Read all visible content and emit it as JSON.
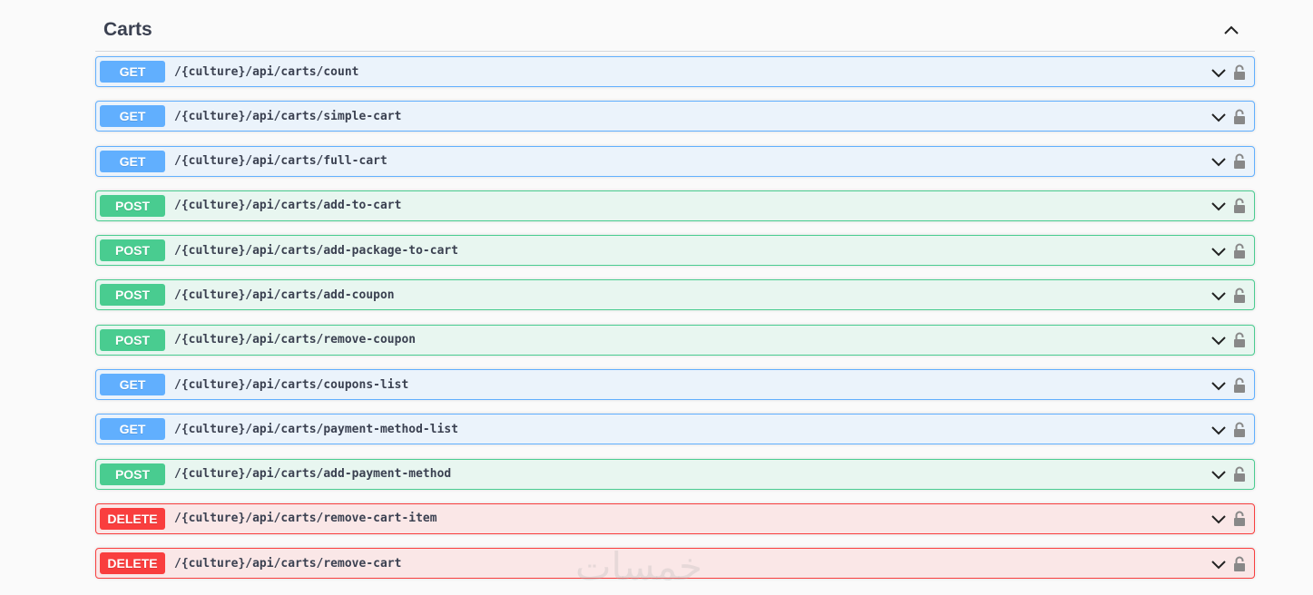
{
  "tag": {
    "title": "Carts"
  },
  "operations": [
    {
      "method": "GET",
      "path": "/{culture}/api/carts/count"
    },
    {
      "method": "GET",
      "path": "/{culture}/api/carts/simple-cart"
    },
    {
      "method": "GET",
      "path": "/{culture}/api/carts/full-cart"
    },
    {
      "method": "POST",
      "path": "/{culture}/api/carts/add-to-cart"
    },
    {
      "method": "POST",
      "path": "/{culture}/api/carts/add-package-to-cart"
    },
    {
      "method": "POST",
      "path": "/{culture}/api/carts/add-coupon"
    },
    {
      "method": "POST",
      "path": "/{culture}/api/carts/remove-coupon"
    },
    {
      "method": "GET",
      "path": "/{culture}/api/carts/coupons-list"
    },
    {
      "method": "GET",
      "path": "/{culture}/api/carts/payment-method-list"
    },
    {
      "method": "POST",
      "path": "/{culture}/api/carts/add-payment-method"
    },
    {
      "method": "DELETE",
      "path": "/{culture}/api/carts/remove-cart-item"
    },
    {
      "method": "DELETE",
      "path": "/{culture}/api/carts/remove-cart"
    }
  ],
  "watermark": "خمسات",
  "colors": {
    "get": "#61affe",
    "post": "#49cc90",
    "delete": "#f93e3e",
    "text": "#3b4151"
  }
}
